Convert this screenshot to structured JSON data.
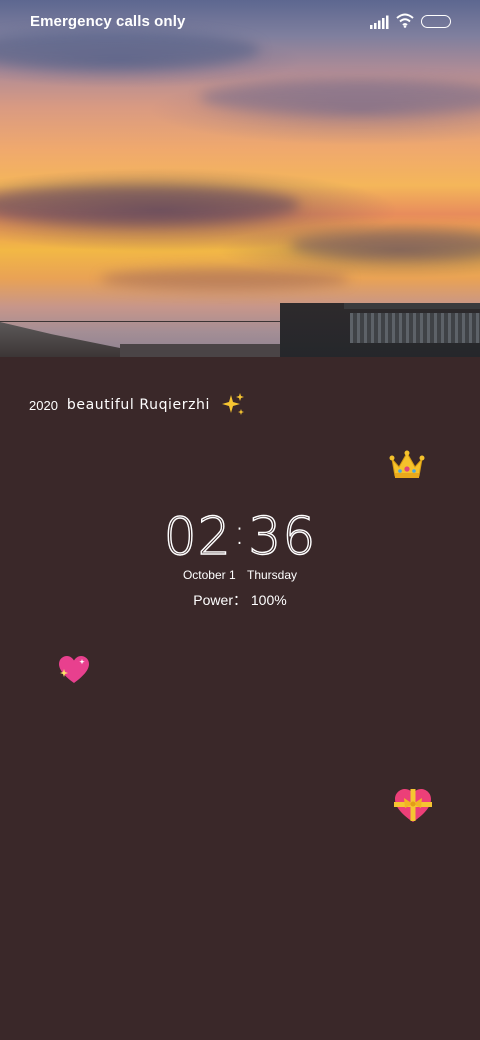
{
  "status_bar": {
    "carrier_text": "Emergency calls only",
    "icons": [
      "signal-icon",
      "wifi-icon",
      "battery-icon"
    ]
  },
  "lockscreen": {
    "greeting_year": "2020",
    "greeting_text": "beautiful Ruqierzhi",
    "greeting_icon": "sparkles-icon",
    "clock_hours": "02",
    "clock_minutes": "36",
    "date": "October 1",
    "weekday": "Thursday",
    "power_label": "Power：",
    "power_value": "100%"
  },
  "decorations": [
    "crown-emoji-icon",
    "sparkling-heart-emoji-icon",
    "heart-with-ribbon-emoji-icon"
  ],
  "colors": {
    "background": "#3a2829",
    "text": "#ffffff"
  }
}
